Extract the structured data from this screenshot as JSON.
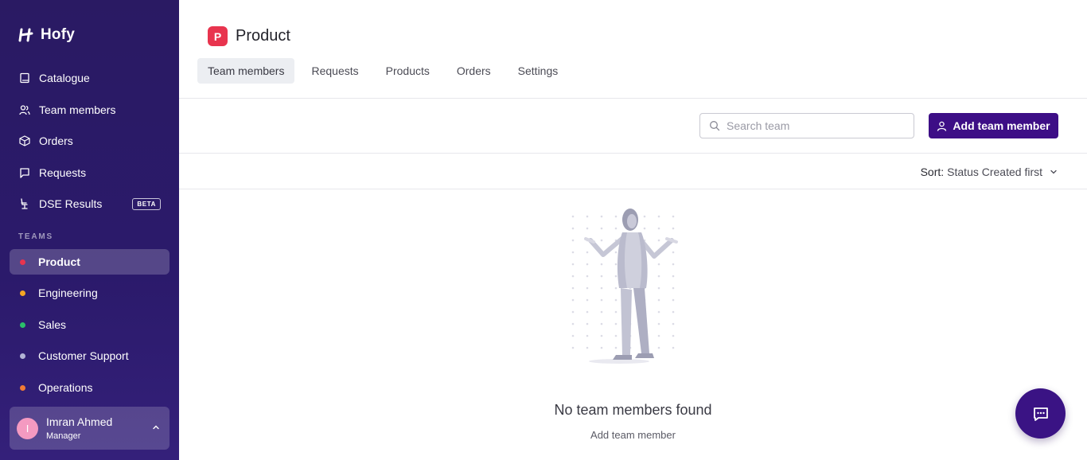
{
  "brand": {
    "name": "Hofy"
  },
  "nav": {
    "items": [
      {
        "label": "Catalogue",
        "icon": "book-icon"
      },
      {
        "label": "Team members",
        "icon": "users-icon"
      },
      {
        "label": "Orders",
        "icon": "box-icon"
      },
      {
        "label": "Requests",
        "icon": "chat-bubble-icon"
      },
      {
        "label": "DSE Results",
        "icon": "desk-chair-icon",
        "badge": "BETA"
      }
    ]
  },
  "teams": {
    "label": "TEAMS",
    "items": [
      {
        "label": "Product",
        "color": "#e8344e",
        "active": true
      },
      {
        "label": "Engineering",
        "color": "#f5a623"
      },
      {
        "label": "Sales",
        "color": "#2bbf6a"
      },
      {
        "label": "Customer Support",
        "color": "#b3b3d6"
      },
      {
        "label": "Operations",
        "color": "#f27b35"
      }
    ]
  },
  "user": {
    "initial": "I",
    "name": "Imran Ahmed",
    "role": "Manager"
  },
  "page": {
    "badge": "P",
    "title": "Product"
  },
  "tabs": [
    {
      "label": "Team members",
      "active": true
    },
    {
      "label": "Requests"
    },
    {
      "label": "Products"
    },
    {
      "label": "Orders"
    },
    {
      "label": "Settings"
    }
  ],
  "search": {
    "placeholder": "Search team",
    "value": ""
  },
  "add_button": {
    "label": "Add team member"
  },
  "sort": {
    "label": "Sort:",
    "value": "Status Created first"
  },
  "empty_state": {
    "title": "No team members found",
    "link": "Add team member"
  },
  "colors": {
    "accent": "#3d0e86",
    "sidebar": "#2b1a6b"
  }
}
